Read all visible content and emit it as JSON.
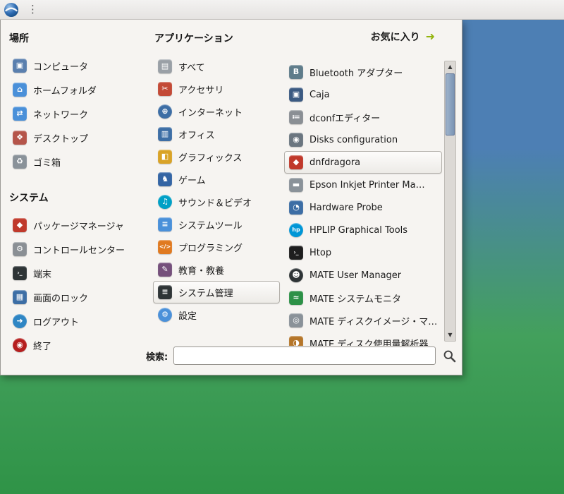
{
  "desktop": {
    "bg_top": "#4d7fb4",
    "bg_mid": "#43a05c",
    "bg_bottom": "#2f9347"
  },
  "panel": {
    "menu_dots": "⋮"
  },
  "menu": {
    "places": {
      "header": "場所",
      "items": [
        {
          "name": "computer",
          "label": "コンピュータ",
          "glyph": "▣",
          "color": "#5a7fae"
        },
        {
          "name": "home-folder",
          "label": "ホームフォルダ",
          "glyph": "⌂",
          "color": "#4a90d9"
        },
        {
          "name": "network",
          "label": "ネットワーク",
          "glyph": "⇄",
          "color": "#4a90d9"
        },
        {
          "name": "desktop",
          "label": "デスクトップ",
          "glyph": "❖",
          "color": "#b5554a"
        },
        {
          "name": "trash",
          "label": "ゴミ箱",
          "glyph": "♻",
          "color": "#8a9299"
        }
      ]
    },
    "system": {
      "header": "システム",
      "items": [
        {
          "name": "package-manager",
          "label": "パッケージマネージャ",
          "glyph": "◆",
          "color": "#c0392b"
        },
        {
          "name": "control-center",
          "label": "コントロールセンター",
          "glyph": "⚙",
          "color": "#8a8f94"
        },
        {
          "name": "terminal",
          "label": "端末",
          "glyph": "›_",
          "color": "#2e3436"
        },
        {
          "name": "lock-screen",
          "label": "画面のロック",
          "glyph": "▦",
          "color": "#3d6ea5"
        },
        {
          "name": "logout",
          "label": "ログアウト",
          "glyph": "➜",
          "color": "#2f86c4",
          "round": true
        },
        {
          "name": "shutdown",
          "label": "終了",
          "glyph": "◉",
          "color": "#b51e1e",
          "round": true
        }
      ]
    },
    "applications": {
      "header": "アプリケーション",
      "items": [
        {
          "name": "all-applications",
          "label": "すべて",
          "glyph": "▤",
          "color": "#9aa0a6"
        },
        {
          "name": "accessories",
          "label": "アクセサリ",
          "glyph": "✂",
          "color": "#c34a36"
        },
        {
          "name": "internet",
          "label": "インターネット",
          "glyph": "⊕",
          "color": "#3d6ea5",
          "round": true
        },
        {
          "name": "office",
          "label": "オフィス",
          "glyph": "▥",
          "color": "#3d6ea5"
        },
        {
          "name": "graphics",
          "label": "グラフィックス",
          "glyph": "◧",
          "color": "#d9a327"
        },
        {
          "name": "games",
          "label": "ゲーム",
          "glyph": "♞",
          "color": "#3465a4"
        },
        {
          "name": "sound-video",
          "label": "サウンド＆ビデオ",
          "glyph": "♫",
          "color": "#00a0c6",
          "round": true
        },
        {
          "name": "system-tools",
          "label": "システムツール",
          "glyph": "≡",
          "color": "#4a90d9"
        },
        {
          "name": "programming",
          "label": "プログラミング",
          "glyph": "</>",
          "color": "#e07a20"
        },
        {
          "name": "education",
          "label": "教育・教養",
          "glyph": "✎",
          "color": "#75507b"
        },
        {
          "name": "system-administration",
          "label": "システム管理",
          "glyph": "≡",
          "color": "#2e3436",
          "selected": true
        },
        {
          "name": "settings",
          "label": "設定",
          "glyph": "⚙",
          "color": "#4a90d9",
          "round": true
        }
      ]
    },
    "favorites": {
      "label": "お気に入り",
      "arrow_glyph": "➜",
      "arrow_color": "#93b40e"
    },
    "apps_list": {
      "items": [
        {
          "name": "bluetooth-adapter",
          "label": "Bluetooth アダプター",
          "glyph": "B",
          "color": "#5f7c8a"
        },
        {
          "name": "caja",
          "label": "Caja",
          "glyph": "▣",
          "color": "#3b5a82"
        },
        {
          "name": "dconf-editor",
          "label": "dconfエディター",
          "glyph": "≔",
          "color": "#8a8f94"
        },
        {
          "name": "disks-configuration",
          "label": "Disks configuration",
          "glyph": "◉",
          "color": "#6b7680"
        },
        {
          "name": "dnfdragora",
          "label": "dnfdragora",
          "glyph": "◆",
          "color": "#c0392b",
          "selected": true
        },
        {
          "name": "epson-inkjet-printer",
          "label": "Epson Inkjet Printer Ma…",
          "glyph": "▬",
          "color": "#8a9299"
        },
        {
          "name": "hardware-probe",
          "label": "Hardware Probe",
          "glyph": "◔",
          "color": "#3d6ea5"
        },
        {
          "name": "hplip-graphical-tools",
          "label": "HPLIP Graphical Tools",
          "glyph": "hp",
          "color": "#0096d6",
          "round": true
        },
        {
          "name": "htop",
          "label": "Htop",
          "glyph": "›_",
          "color": "#1e1e1e"
        },
        {
          "name": "mate-user-manager",
          "label": "MATE User Manager",
          "glyph": "☻",
          "color": "#2e3436",
          "round": true
        },
        {
          "name": "mate-system-monitor",
          "label": "MATE システムモニタ",
          "glyph": "≈",
          "color": "#2d9147"
        },
        {
          "name": "mate-disk-image",
          "label": "MATE ディスクイメージ・マ…",
          "glyph": "◎",
          "color": "#8a9299"
        },
        {
          "name": "mate-disk-usage",
          "label": "MATE ディスク使用量解析器",
          "glyph": "◑",
          "color": "#b5762a"
        }
      ]
    },
    "scrollbar": {
      "up_glyph": "▲",
      "down_glyph": "▼"
    },
    "search": {
      "label": "検索:",
      "value": ""
    }
  }
}
